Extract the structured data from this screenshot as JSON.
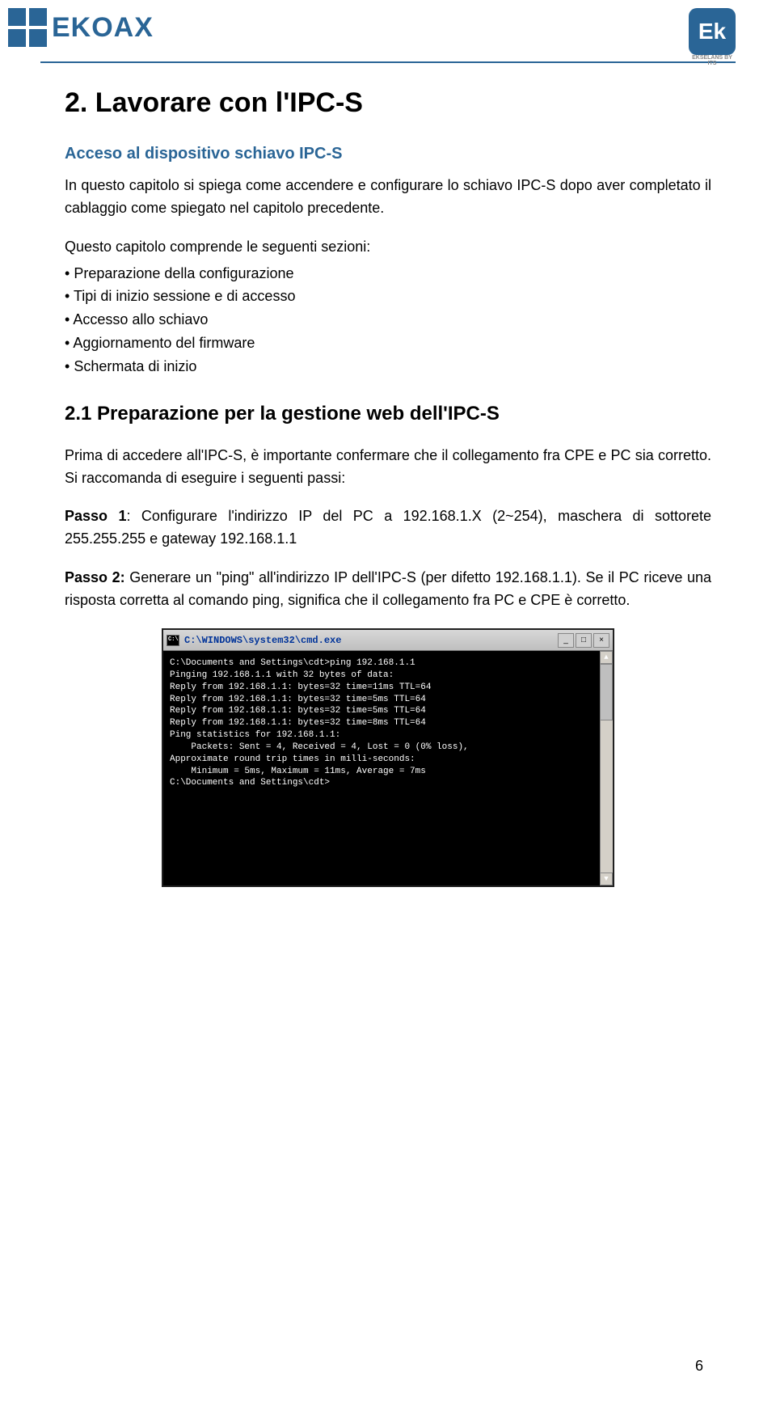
{
  "header": {
    "logo_text": "EKOAX",
    "ek_text": "Ek",
    "ek_sub": "EKSELANS BY ITS"
  },
  "h1": "2. Lavorare con l'IPC-S",
  "section1_title": "Acceso al dispositivo schiavo IPC-S",
  "p1": "In questo capitolo si spiega come accendere e configurare lo schiavo IPC-S dopo aver completato il cablaggio come spiegato nel capitolo precedente.",
  "p2_intro": "Questo capitolo comprende le seguenti sezioni:",
  "bullets": [
    "Preparazione della configurazione",
    "Tipi di inizio sessione e di accesso",
    "Accesso allo schiavo",
    "Aggiornamento del firmware",
    "Schermata di inizio"
  ],
  "h2": "2.1 Preparazione per la gestione web dell'IPC-S",
  "p3": "Prima di accedere all'IPC-S, è importante confermare che il collegamento fra CPE e PC sia corretto. Si raccomanda di eseguire i seguenti passi:",
  "passo1_label": "Passo 1",
  "passo1_text": ": Configurare l'indirizzo IP del PC a 192.168.1.X (2~254), maschera di sottorete 255.255.255 e gateway 192.168.1.1",
  "passo2_label": "Passo 2:",
  "passo2_text": " Generare un \"ping\" all'indirizzo IP dell'IPC-S (per difetto 192.168.1.1). Se il PC riceve una risposta corretta al comando ping, significa che il collegamento fra PC e CPE è corretto.",
  "cmd": {
    "title": "C:\\WINDOWS\\system32\\cmd.exe",
    "lines": [
      "C:\\Documents and Settings\\cdt>ping 192.168.1.1",
      "",
      "Pinging 192.168.1.1 with 32 bytes of data:",
      "",
      "Reply from 192.168.1.1: bytes=32 time=11ms TTL=64",
      "Reply from 192.168.1.1: bytes=32 time=5ms TTL=64",
      "Reply from 192.168.1.1: bytes=32 time=5ms TTL=64",
      "Reply from 192.168.1.1: bytes=32 time=8ms TTL=64",
      "",
      "Ping statistics for 192.168.1.1:",
      "    Packets: Sent = 4, Received = 4, Lost = 0 (0% loss),",
      "Approximate round trip times in milli-seconds:",
      "    Minimum = 5ms, Maximum = 11ms, Average = 7ms",
      "",
      "C:\\Documents and Settings\\cdt>"
    ]
  },
  "page_number": "6"
}
